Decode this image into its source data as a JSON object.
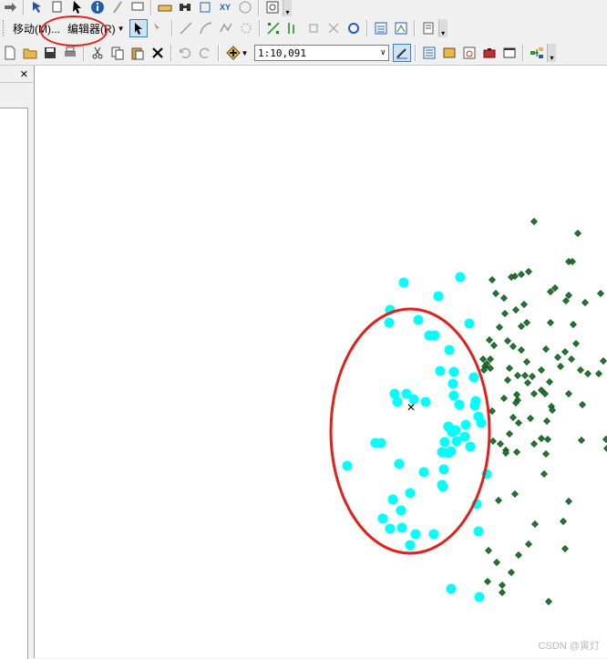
{
  "toolbar_top": {
    "icons": [
      "arrow-right-icon",
      "select-features-icon",
      "page-icon",
      "select-elements-icon",
      "identify-icon",
      "html-popup-icon",
      "hyperlink-icon",
      "measure-icon",
      "find-icon",
      "go-to-xy-icon",
      "xy-icon",
      "time-slider-icon",
      "magnifier-icon"
    ],
    "xy_label": "XY"
  },
  "toolbar_editor": {
    "move_label": "移动(M)...",
    "editor_label": "编辑器(R)",
    "icons": [
      "edit-tool-icon",
      "edit-annotation-icon",
      "straight-segment-icon",
      "end-point-arc-icon",
      "trace-icon",
      "midpoint-icon",
      "cut-polygons-icon",
      "split-icon",
      "rotate-icon",
      "attributes-icon",
      "sketch-properties-icon",
      "edit-vertices-icon",
      "reshape-icon",
      "create-features-icon"
    ]
  },
  "toolbar_standard": {
    "scale_value": "1:10,091",
    "icons": [
      "new-icon",
      "open-icon",
      "save-icon",
      "print-icon",
      "cut-icon",
      "copy-icon",
      "paste-icon",
      "delete-icon",
      "undo-icon",
      "redo-icon",
      "add-data-icon",
      "editor-toolbar-icon",
      "table-of-contents-icon",
      "catalog-icon",
      "search-window-icon",
      "arctoolbox-icon",
      "python-window-icon",
      "model-builder-icon"
    ]
  },
  "side_panel": {
    "pin_label": "ᅟ",
    "close_label": "✕"
  },
  "map": {
    "cursor_symbol": "✕",
    "colors": {
      "cyan_points": "#00ffff",
      "green_points": "#1e7a2e",
      "highlight": "#e0201b",
      "background": "#ffffff"
    },
    "cyan_point_count": 58,
    "green_point_count": 100
  },
  "watermark": "CSDN @寅灯"
}
